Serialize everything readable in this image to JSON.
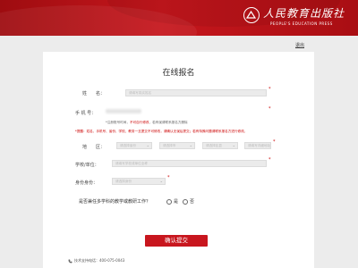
{
  "header": {
    "logo_cn": "人民教育出版社",
    "logo_en": "PEOPLE'S EDUCATION PRESS",
    "logout_label": "退出"
  },
  "form": {
    "title": "在线报名",
    "name": {
      "label": "姓　　名：",
      "placeholder": "请填写真实姓名"
    },
    "phone": {
      "label": "手 机 号：",
      "hint_prefix": "*注册账号时间，",
      "hint_red": "不可自行修改",
      "hint_suffix": "，若有误请联系报名方删除"
    },
    "notice": "*提醒：姓名、手机号、省份、学校、教务一旦提交不可修改，请确认无误后提交；若有特殊问题请联系报名方进行修改。",
    "region": {
      "label": "地　　区：",
      "province": "请选择省份",
      "city": "请选择市",
      "district": "请选择区县",
      "detail": "请填写详细地址"
    },
    "school": {
      "label": "学校/单位：",
      "placeholder": "请填写学校或单位全称"
    },
    "identity": {
      "label": "身份身份：",
      "placeholder": "请选择身份"
    },
    "question": "是否兼任多学科的教学或教研工作？",
    "option_yes": "是",
    "option_no": "否",
    "submit_label": "确认提交",
    "support": "技术支持电话：400-075-0043"
  }
}
